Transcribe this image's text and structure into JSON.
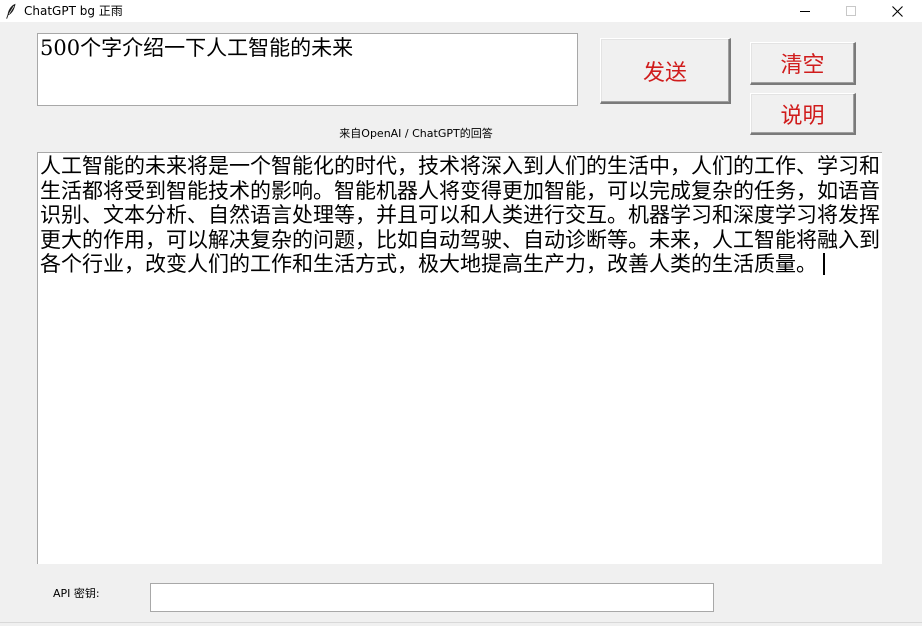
{
  "window": {
    "title": "ChatGPT bg 正雨",
    "icons": {
      "app": "feather-icon",
      "minimize": "minimize-icon",
      "maximize": "maximize-icon",
      "close": "close-icon"
    }
  },
  "prompt": {
    "value": "500个字介绍一下人工智能的未来"
  },
  "buttons": {
    "send_label": "发送",
    "clear_label": "清空",
    "help_label": "说明"
  },
  "response": {
    "label": "来自OpenAI / ChatGPT的回答",
    "text": "人工智能的未来将是一个智能化的时代，技术将深入到人们的生活中，人们的工作、学习和生活都将受到智能技术的影响。智能机器人将变得更加智能，可以完成复杂的任务，如语音识别、文本分析、自然语言处理等，并且可以和人类进行交互。机器学习和深度学习将发挥更大的作用，可以解决复杂的问题，比如自动驾驶、自动诊断等。未来，人工智能将融入到各个行业，改变人们的工作和生活方式，极大地提高生产力，改善人类的生活质量。"
  },
  "api": {
    "label": "API 密钥:",
    "value": ""
  },
  "colors": {
    "button_text": "#d01c1c",
    "window_bg": "#f0f0f0",
    "field_bg": "#ffffff"
  }
}
